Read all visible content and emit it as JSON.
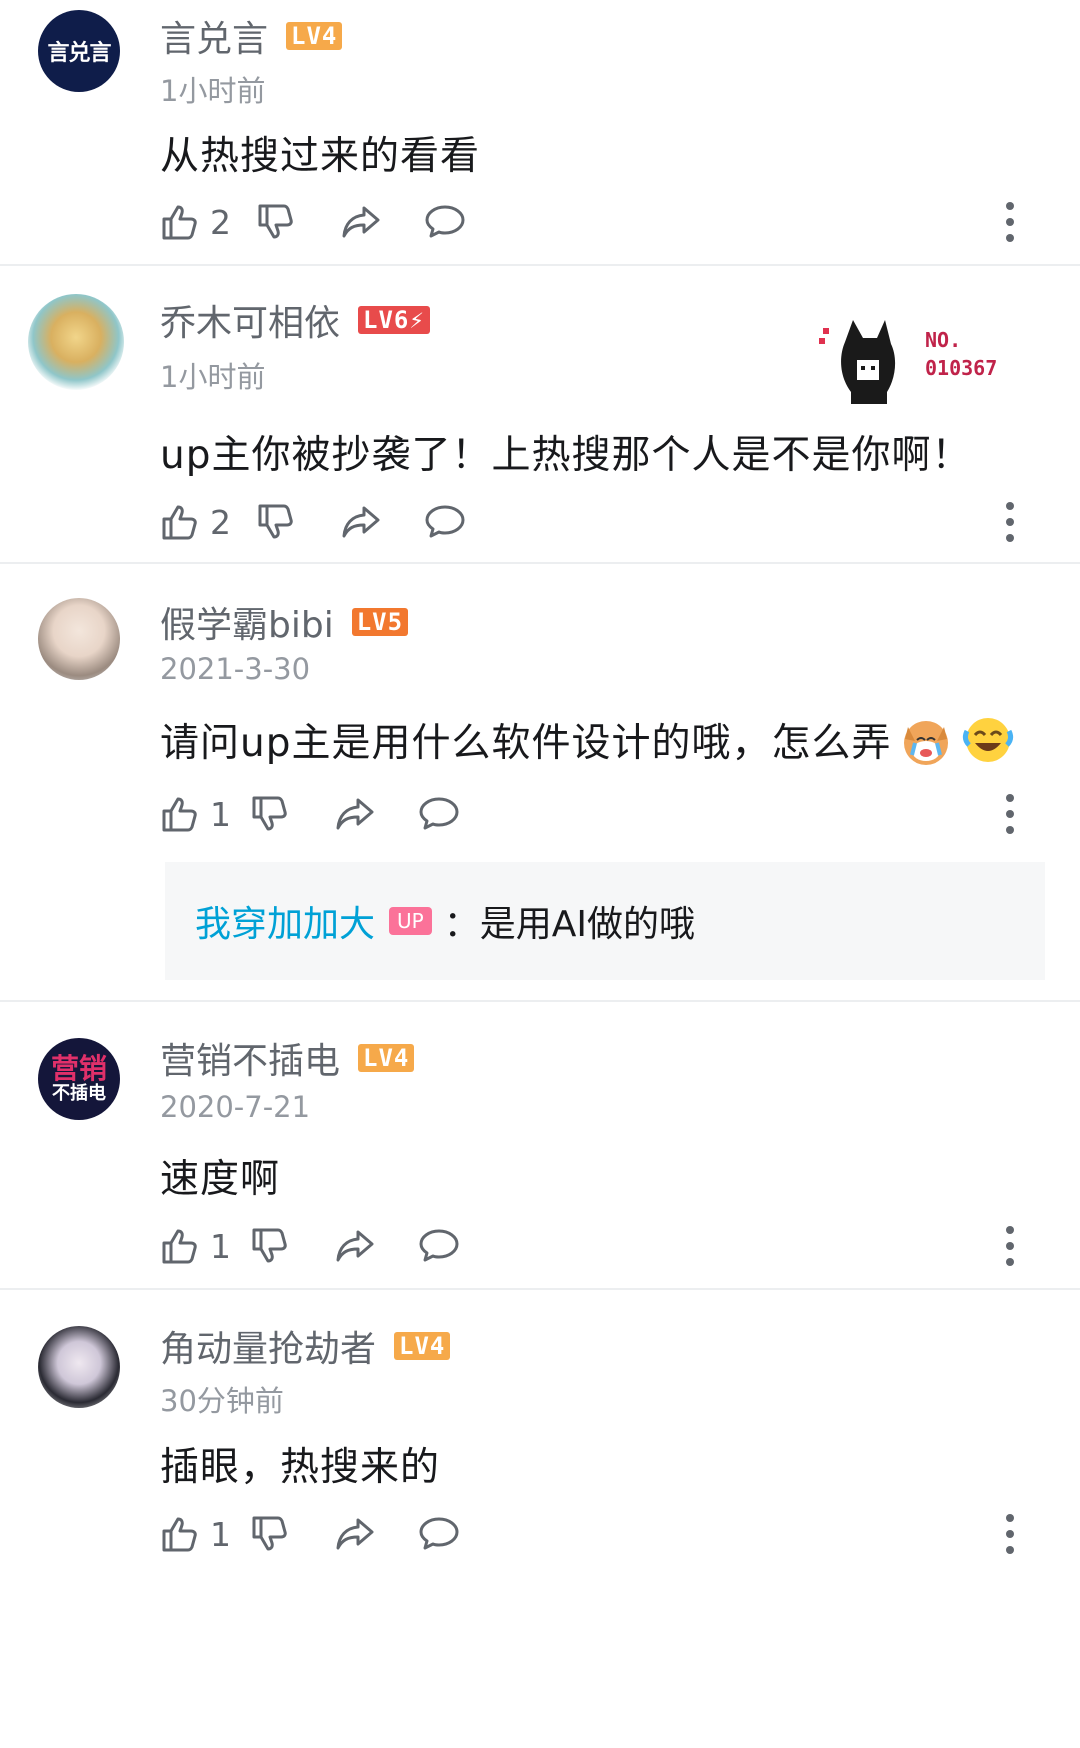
{
  "comments": [
    {
      "username": "言兑言",
      "avatar_text": "言兑言",
      "level": "LV4",
      "level_color": "#f6a94a",
      "time": "1小时前",
      "content": "从热搜过来的看看",
      "likes": "2"
    },
    {
      "username": "乔木可相依",
      "level": "LV6⚡",
      "level_color": "#e84b4b",
      "time": "1小时前",
      "content": "up主你被抄袭了！上热搜那个人是不是你啊！",
      "likes": "2",
      "fan_card": {
        "line1": "NO.",
        "line2": "010367"
      }
    },
    {
      "username": "假学霸bibi",
      "level": "LV5",
      "level_color": "#f2782f",
      "time": "2021-3-30",
      "content": "请问up主是用什么软件设计的哦，怎么弄",
      "emojis": [
        "crying-dog-emoji",
        "laughing-crying-emoji"
      ],
      "likes": "1",
      "reply": {
        "username": "我穿加加大",
        "badge": "UP",
        "text": "：是用AI做的哦"
      }
    },
    {
      "username": "营销不插电",
      "avatar_text_top": "营销",
      "avatar_text_bottom": "不插电",
      "level": "LV4",
      "level_color": "#f6a94a",
      "time": "2020-7-21",
      "content": "速度啊",
      "likes": "1"
    },
    {
      "username": "角动量抢劫者",
      "level": "LV4",
      "level_color": "#f6a94a",
      "time": "30分钟前",
      "content": "插眼，热搜来的",
      "likes": "1"
    }
  ],
  "icons": {
    "like": "thumbs-up-icon",
    "dislike": "thumbs-down-icon",
    "share": "share-icon",
    "reply": "comment-icon",
    "more": "more-vertical-icon"
  },
  "colors": {
    "username": "#61666d",
    "time": "#9499a0",
    "reply_user": "#00a1d6",
    "up_badge": "#fb7299"
  }
}
